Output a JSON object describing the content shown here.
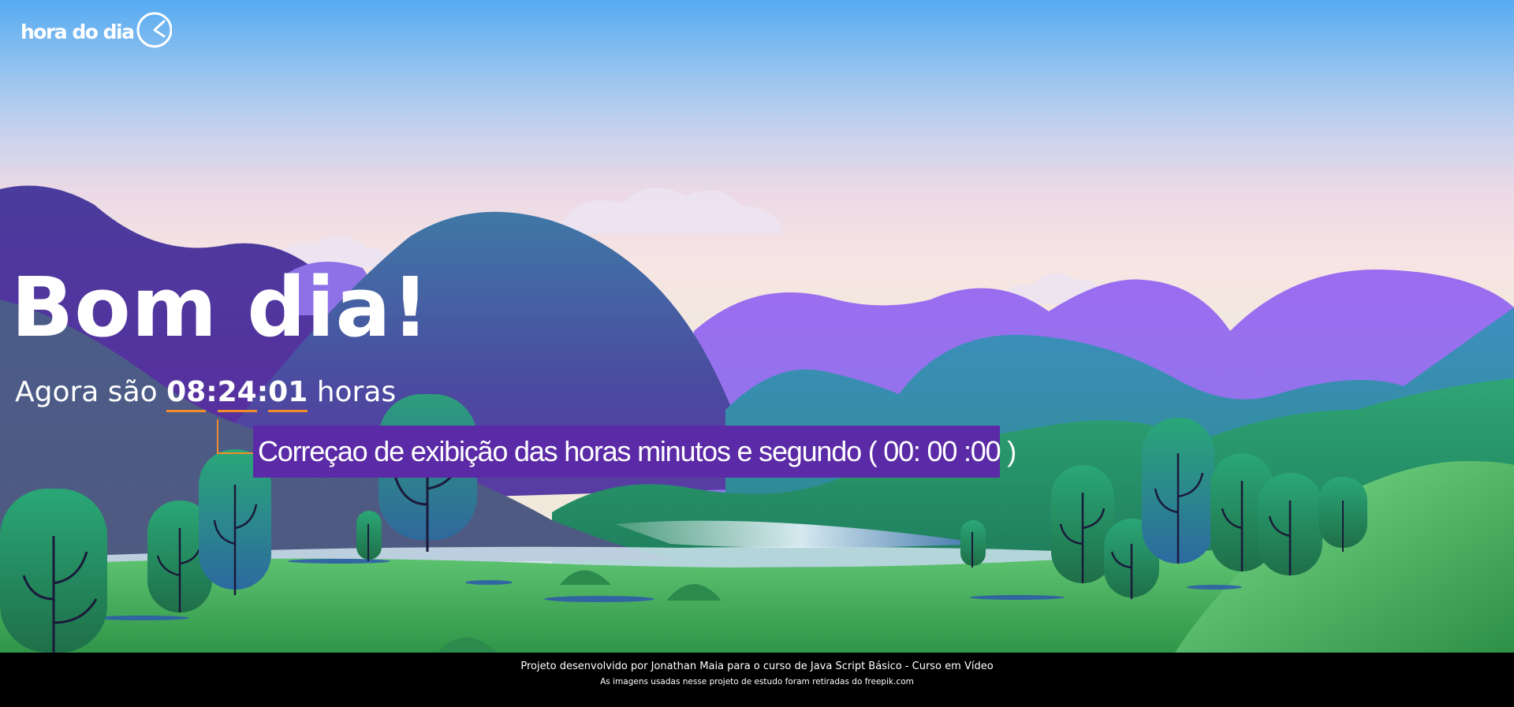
{
  "header": {
    "logo_text": "hora do dia"
  },
  "main": {
    "greeting": "Bom dia!",
    "time_prefix": "Agora são",
    "time": {
      "hours": "08",
      "minutes": "24",
      "seconds": "01"
    },
    "time_suffix": "horas",
    "callout_text": "Correçao de exibição das horas minutos e segundo ( 00: 00 :00 )"
  },
  "footer": {
    "credit": "Projeto desenvolvido por Jonathan Maia para o curso de Java Script Básico - Curso em Vídeo",
    "image_credit": "As imagens usadas nesse projeto de estudo foram retiradas do freepik.com"
  },
  "colors": {
    "accent_orange": "#f28b2c",
    "callout_purple": "#5b2aa6",
    "footer_bg": "#000000",
    "text": "#ffffff"
  },
  "icons": [
    "clock-icon"
  ]
}
